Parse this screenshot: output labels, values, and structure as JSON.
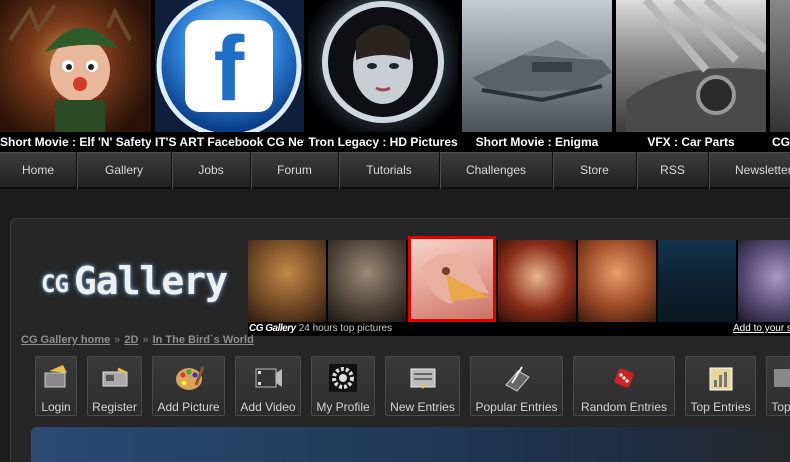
{
  "featured": [
    {
      "caption": "Short Movie : Elf 'N' Safety",
      "icon": "elf-character-image"
    },
    {
      "caption": "IT'S ART Facebook CG News",
      "icon": "facebook-logo-image",
      "letter": "f",
      "color": "#1f6ec7"
    },
    {
      "caption": "Tron Legacy : HD Pictures",
      "icon": "tron-helmet-image"
    },
    {
      "caption": "Short Movie : Enigma",
      "icon": "spaceship-image"
    },
    {
      "caption": "VFX : Car Parts",
      "icon": "car-parts-image"
    },
    {
      "caption": "CG",
      "icon": "partial-image"
    }
  ],
  "nav": [
    "Home",
    "Gallery",
    "Jobs",
    "Forum",
    "Tutorials",
    "Challenges",
    "Store",
    "RSS",
    "Newsletter"
  ],
  "gallery": {
    "logo_cg": "CG",
    "logo_word": "Gallery",
    "caption_bold": "CG Gallery",
    "caption_rest": "24 hours top pictures",
    "caption_link": "Add to your site",
    "thumbs": [
      "warrior-art",
      "steampunk-art",
      "bird-man-art",
      "fire-woman-art",
      "redhead-portrait-art",
      "comic-panels-art",
      "skull-creature-art"
    ],
    "selected_index": 2
  },
  "breadcrumb": {
    "items": [
      "CG Gallery home",
      "2D",
      "In The Bird`s World"
    ],
    "separator": "»"
  },
  "toolbar": [
    {
      "label": "Login",
      "icon": "login-key-icon"
    },
    {
      "label": "Register",
      "icon": "register-card-icon"
    },
    {
      "label": "Add Picture",
      "icon": "palette-icon"
    },
    {
      "label": "Add Video",
      "icon": "film-strip-icon"
    },
    {
      "label": "My Profile",
      "icon": "gear-icon"
    },
    {
      "label": "New Entries",
      "icon": "new-entries-icon"
    },
    {
      "label": "Popular Entries",
      "icon": "tablet-pen-icon"
    },
    {
      "label": "Random Entries",
      "icon": "dice-icon"
    },
    {
      "label": "Top Entries",
      "icon": "chart-note-icon"
    },
    {
      "label": "Top",
      "icon": "top-icon"
    }
  ],
  "colors": {
    "accent_red": "#e00000",
    "facebook_blue": "#1f6ec7",
    "bluebar": "#2c4a75"
  }
}
